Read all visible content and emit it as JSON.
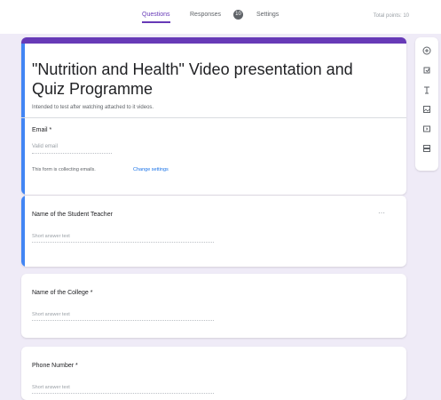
{
  "header": {
    "tabs": [
      {
        "label": "Questions",
        "active": true
      },
      {
        "label": "Responses"
      },
      {
        "label": "Settings"
      }
    ],
    "response_count": "10",
    "total_points": "Total points: 10"
  },
  "form": {
    "title": "\"Nutrition and Health\" Video presentation and Quiz Programme",
    "description": "Intended to test after watching attached to it videos.",
    "email_label": "Email *",
    "email_placeholder": "Valid email",
    "email_note": "This form is collecting emails.",
    "email_change": "Change settings"
  },
  "questions": [
    {
      "label": "Name of the Student Teacher",
      "placeholder": "Short answer text"
    },
    {
      "label": "Name of the College *",
      "placeholder": "Short answer text"
    },
    {
      "label": "Phone Number *",
      "placeholder": "Short answer text"
    }
  ],
  "toolbar_icons": [
    "add-question-icon",
    "import-questions-icon",
    "add-title-icon",
    "add-image-icon",
    "add-video-icon",
    "add-section-icon"
  ],
  "colors": {
    "accent": "#673ab7",
    "focus": "#4285f4",
    "background": "#efebf7"
  }
}
